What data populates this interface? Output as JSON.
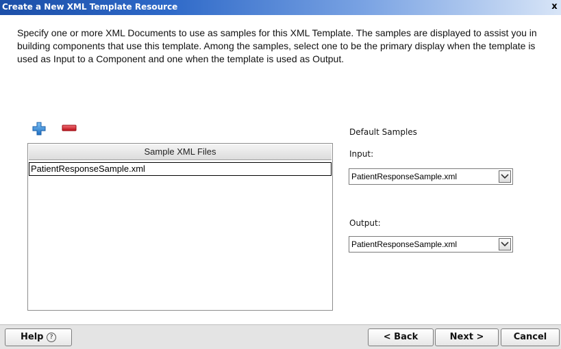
{
  "window": {
    "title": "Create a New XML Template Resource",
    "close_glyph": "x"
  },
  "description": "Specify one or more XML Documents to use as samples for this XML Template. The samples are displayed to assist you in building components that use this template. Among the samples, select one to be the primary display when the template is used as Input to a Component and one when the template is used as Output.",
  "toolbar": {
    "add_icon": "plus-icon",
    "remove_icon": "minus-icon"
  },
  "table": {
    "header": "Sample XML Files",
    "rows": [
      "PatientResponseSample.xml"
    ]
  },
  "defaults": {
    "section_label": "Default Samples",
    "input_label": "Input:",
    "input_value": "PatientResponseSample.xml",
    "output_label": "Output:",
    "output_value": "PatientResponseSample.xml"
  },
  "footer": {
    "help_label": "Help",
    "help_glyph": "?",
    "back_label": "< Back",
    "next_label": "Next >",
    "cancel_label": "Cancel"
  },
  "colors": {
    "titlebar_start": "#1c4fa8",
    "titlebar_end": "#d8e5f7",
    "add_icon": "#3a8fd8",
    "remove_icon": "#d4151e"
  }
}
